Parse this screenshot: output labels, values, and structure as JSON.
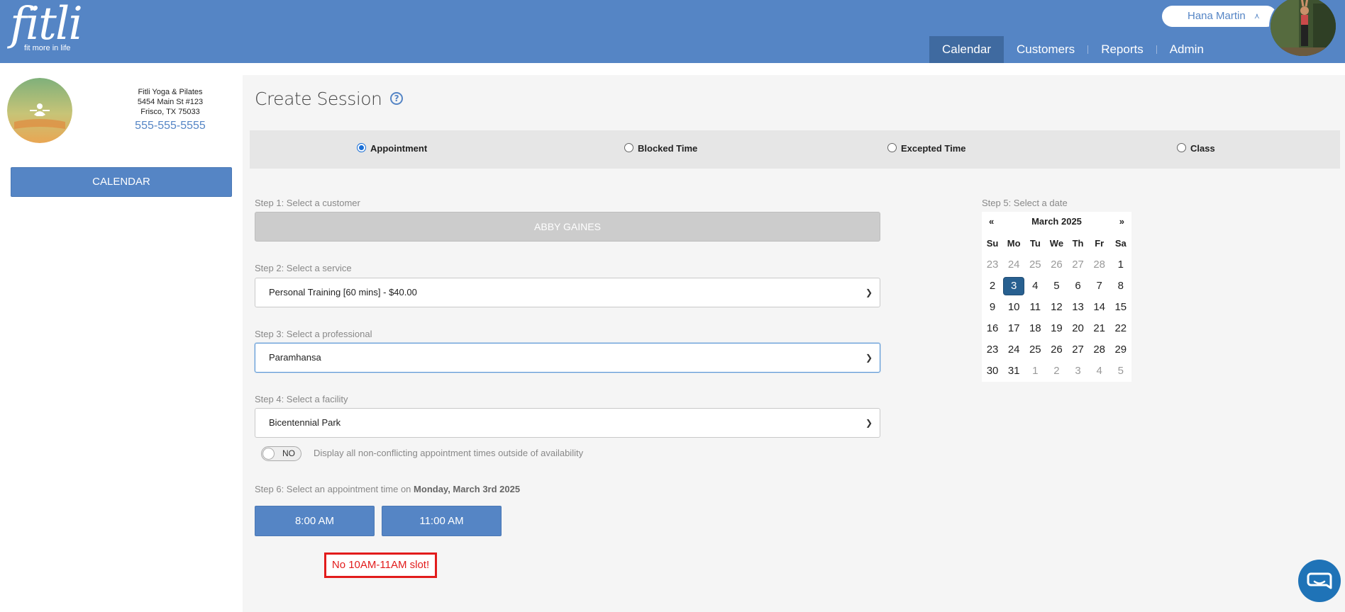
{
  "header": {
    "logo_word": "fitli",
    "logo_tagline": "fit more in life",
    "user_name": "Hana Martin",
    "nav": [
      "Calendar",
      "Customers",
      "Reports",
      "Admin"
    ],
    "active_nav": "Calendar"
  },
  "business": {
    "name": "Fitli Yoga & Pilates",
    "address1": "5454 Main St #123",
    "address2": "Frisco, TX 75033",
    "phone": "555-555-5555",
    "logo_text": "FITLI YOGA & PILATES"
  },
  "sidebar": {
    "calendar_button": "CALENDAR"
  },
  "page": {
    "title": "Create Session",
    "help_glyph": "?"
  },
  "session_types": {
    "options": [
      "Appointment",
      "Blocked Time",
      "Excepted Time",
      "Class"
    ],
    "selected": "Appointment"
  },
  "steps": {
    "step1_label": "Step 1: Select a customer",
    "customer": "ABBY GAINES",
    "step2_label": "Step 2: Select a service",
    "service": "Personal Training [60 mins] - $40.00",
    "step3_label": "Step 3: Select a professional",
    "professional": "Paramhansa",
    "step4_label": "Step 4: Select a facility",
    "facility": "Bicentennial Park",
    "toggle_state": "NO",
    "toggle_description": "Display all non-conflicting appointment times outside of availability",
    "step5_label": "Step 5: Select a date",
    "step6_label": "Step 6: Select an appointment time on",
    "step6_date": "Monday, March 3rd 2025"
  },
  "times": [
    "8:00 AM",
    "11:00 AM"
  ],
  "annotation": "No 10AM-11AM slot!",
  "calendar": {
    "title": "March 2025",
    "prev": "«",
    "next": "»",
    "weekdays": [
      "Su",
      "Mo",
      "Tu",
      "We",
      "Th",
      "Fr",
      "Sa"
    ],
    "selected_day": "3",
    "weeks": [
      [
        "23",
        "24",
        "25",
        "26",
        "27",
        "28",
        "1"
      ],
      [
        "2",
        "3",
        "4",
        "5",
        "6",
        "7",
        "8"
      ],
      [
        "9",
        "10",
        "11",
        "12",
        "13",
        "14",
        "15"
      ],
      [
        "16",
        "17",
        "18",
        "19",
        "20",
        "21",
        "22"
      ],
      [
        "23",
        "24",
        "25",
        "26",
        "27",
        "28",
        "29"
      ],
      [
        "30",
        "31",
        "1",
        "2",
        "3",
        "4",
        "5"
      ]
    ]
  },
  "colors": {
    "brand": "#5585c5",
    "active_nav": "#3f6aa0",
    "selected_day": "#286090",
    "alert": "#e21c1c",
    "chat": "#1f73b7"
  },
  "icons": {
    "help": "help-circle-icon",
    "chevron": "chevron-down-icon",
    "chat": "chat-bubble-icon"
  }
}
